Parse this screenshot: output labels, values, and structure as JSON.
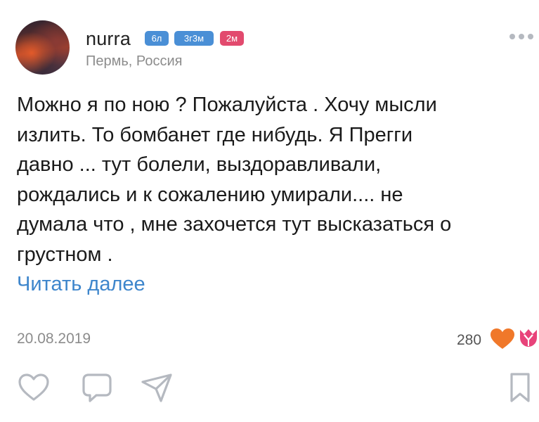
{
  "post": {
    "username": "nurra",
    "badges": [
      "6л",
      "3г3м",
      "2м"
    ],
    "location": "Пермь, Россия",
    "text": "Можно я по ною ? Пожалуйста . Хочу мысли\nизлить. То бомбанет где нибудь. Я Прегги\nдавно ... тут болели, выздоравливали,\nрождались и к сожалению умирали.... не\nдумала что , мне захочется тут высказаться о\nгрустном .",
    "read_more": "Читать далее",
    "date": "20.08.2019",
    "likes": "280"
  },
  "colors": {
    "accent": "#3e86cc",
    "badge_blue": "#4a8fd6",
    "badge_pink": "#e24a6e",
    "like_orange": "#f0782a",
    "tulip_pink": "#e8437a"
  },
  "icons": {
    "menu": "more-dots-icon",
    "reaction": "heart-icon",
    "gift": "tulip-icon",
    "like_action": "heart-outline-icon",
    "comment_action": "comment-icon",
    "share_action": "share-icon",
    "save_action": "bookmark-icon"
  }
}
